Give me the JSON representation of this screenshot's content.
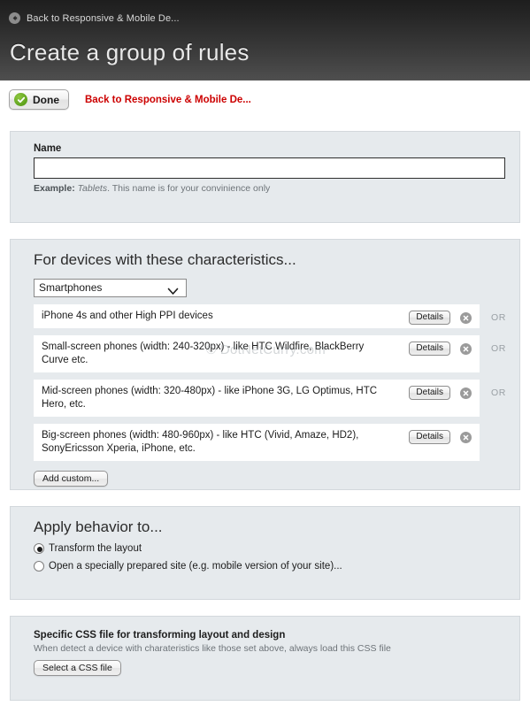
{
  "header": {
    "back_link": "Back to Responsive & Mobile De...",
    "back_icon": "arrow-left-circle-icon",
    "title": "Create a group of rules"
  },
  "toolbar": {
    "done_label": "Done",
    "done_icon": "check-circle-icon",
    "back_link": "Back to Responsive & Mobile De..."
  },
  "name_panel": {
    "label": "Name",
    "value": "",
    "placeholder": "",
    "hint_prefix": "Example: ",
    "hint_italic": "Tablets",
    "hint_suffix": ". This name is for your convinience only"
  },
  "devices_panel": {
    "title": "For devices with these characteristics...",
    "select_value": "Smartphones",
    "select_options": [
      "Smartphones"
    ],
    "select_icon": "chevron-down-icon",
    "details_label": "Details",
    "delete_icon": "delete-circle-icon",
    "or_label": "OR",
    "add_custom_label": "Add custom...",
    "rows": [
      {
        "text": "iPhone 4s and other High PPI devices",
        "or": "OR"
      },
      {
        "text": "Small-screen phones (width: 240-320px) - like HTC Wildfire, BlackBerry Curve etc.",
        "or": "OR"
      },
      {
        "text": "Mid-screen phones (width: 320-480px) - like iPhone 3G, LG Optimus, HTC Hero, etc.",
        "or": "OR"
      },
      {
        "text": "Big-screen phones (width: 480-960px) - like HTC (Vivid, Amaze, HD2), SonyEricsson Xperia, iPhone, etc.",
        "or": ""
      }
    ]
  },
  "behavior_panel": {
    "title": "Apply behavior to...",
    "options": [
      {
        "label": "Transform the layout",
        "selected": true
      },
      {
        "label": "Open a specially prepared site (e.g. mobile version of your site)...",
        "selected": false
      }
    ]
  },
  "css_panel": {
    "title": "Specific CSS file for transforming layout and design",
    "description": "When detect a device with charateristics like those set above, always load this CSS file",
    "button_label": "Select a CSS file"
  },
  "watermark": "© DotNetCurry.com",
  "colors": {
    "panel_bg": "#e6eaed",
    "panel_border": "#d3d8dc",
    "link_red": "#cc0000",
    "check_green": "#5ea21c"
  }
}
